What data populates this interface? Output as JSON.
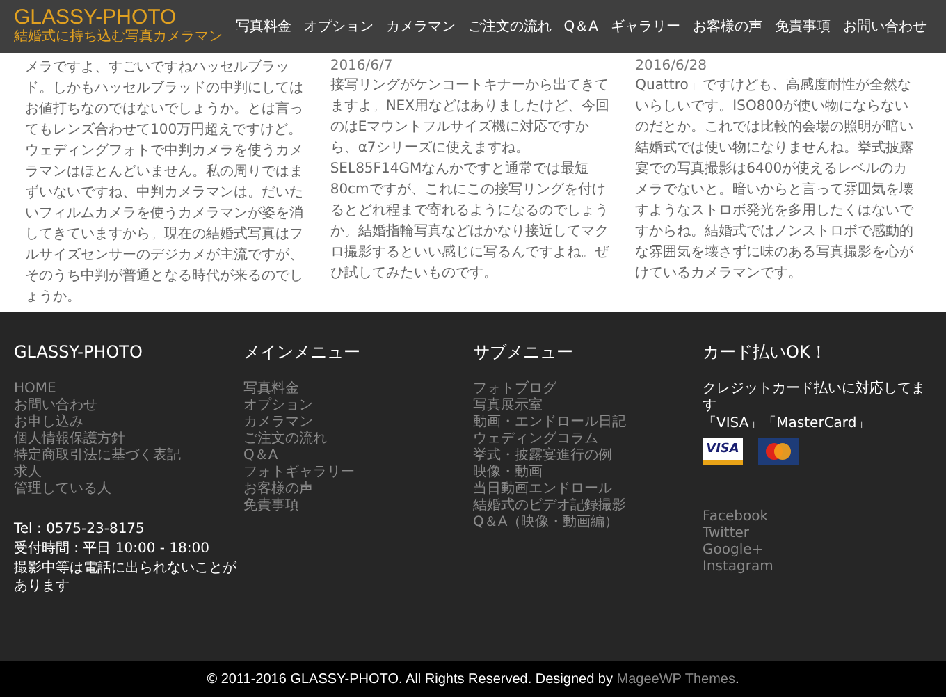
{
  "header": {
    "logo": "GLASSY-PHOTO",
    "tagline": "結婚式に持ち込む写真カメラマン",
    "nav": [
      "写真料金",
      "オプション",
      "カメラマン",
      "ご注文の流れ",
      "Q＆A",
      "ギャラリー",
      "お客様の声",
      "免責事項",
      "お問い合わせ"
    ]
  },
  "posts": [
    {
      "text": "メラですよ、すごいですねハッセルブラッド。しかもハッセルブラッドの中判にしてはお値打ちなのではないでしょうか。とは言ってもレンズ合わせて100万円超えですけど。ウェディングフォトで中判カメラを使うカメラマンはほとんどいません。私の周りではまずいないですね、中判カメラマンは。だいたいフィルムカメラを使うカメラマンが姿を消してきていますから。現在の結婚式写真はフルサイズセンサーのデジカメが主流ですが、そのうち中判が普通となる時代が来るのでしょうか。"
    },
    {
      "date": "2016/6/7",
      "text": "接写リングがケンコートキナーから出てきてますよ。NEX用などはありましたけど、今回のはEマウントフルサイズ機に対応ですから、α7シリーズに使えますね。SEL85F14GMなんかですと通常では最短80cmですが、これにこの接写リングを付けるとどれ程まで寄れるようになるのでしょうか。結婚指輪写真などはかなり接近してマクロ撮影するといい感じに写るんですよね。ぜひ試してみたいものです。"
    },
    {
      "date": "2016/6/28",
      "text": "Quattro」ですけども、高感度耐性が全然ないらしいです。ISO800が使い物にならないのだとか。これでは比較的会場の照明が暗い結婚式では使い物になりませんね。挙式披露宴での写真撮影は6400が使えるレベルのカメラでないと。暗いからと言って雰囲気を壊すようなストロボ発光を多用したくはないですからね。結婚式ではノンストロボで感動的な雰囲気を壊さずに味のある写真撮影を心がけているカメラマンです。"
    }
  ],
  "footer": {
    "columns": [
      {
        "kind": "site",
        "title": "GLASSY-PHOTO",
        "links": [
          "HOME",
          "お問い合わせ",
          "お申し込み",
          "個人情報保護方針",
          "特定商取引法に基づく表記",
          "求人",
          "管理している人"
        ],
        "contact": [
          "Tel : 0575-23-8175",
          "受付時間 : 平日 10:00 - 18:00",
          "撮影中等は電話に出られないことがあります"
        ]
      },
      {
        "kind": "menu",
        "title": "メインメニュー",
        "links": [
          "写真料金",
          "オプション",
          "カメラマン",
          "ご注文の流れ",
          "Q＆A",
          "フォトギャラリー",
          "お客様の声",
          "免責事項"
        ]
      },
      {
        "kind": "menu",
        "title": "サブメニュー",
        "links": [
          "フォトブログ",
          "写真展示室",
          "動画・エンドロール日記",
          "ウェディングコラム",
          "挙式・披露宴進行の例",
          "映像・動画",
          "当日動画エンドロール",
          "結婚式のビデオ記録撮影",
          "Q＆A（映像・動画編）"
        ]
      },
      {
        "kind": "payment",
        "title": "カード払いOK！",
        "text": "クレジットカード払いに対応してます",
        "brands": "「VISA」「MasterCard」",
        "cards": [
          {
            "kind": "visa",
            "label": "VISA"
          },
          {
            "kind": "mastercard"
          }
        ],
        "social": [
          "Facebook",
          "Twitter",
          "Google+",
          "Instagram"
        ]
      }
    ]
  },
  "copyright": {
    "before": "© 2011-2016 GLASSY-PHOTO. All Rights Reserved. Designed by ",
    "link": "MageeWP Themes",
    "after": "."
  }
}
